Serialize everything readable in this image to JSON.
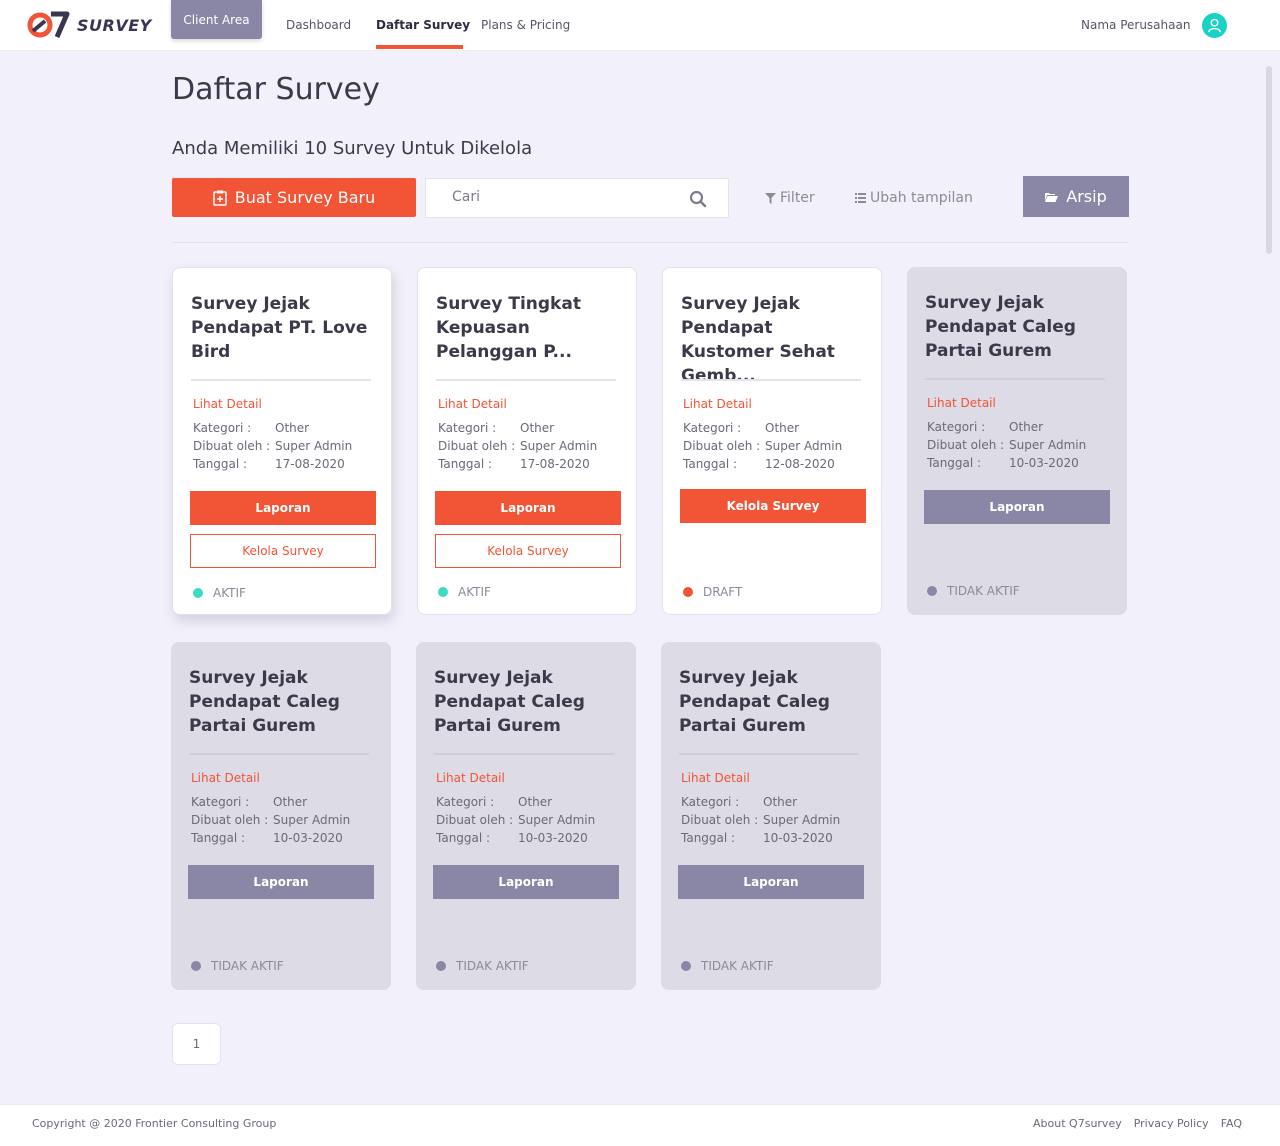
{
  "brand": {
    "logo_text": "SURVEY"
  },
  "nav": {
    "client_area": "Client Area",
    "links": [
      "Dashboard",
      "Daftar Survey",
      "Plans & Pricing"
    ],
    "company": "Nama Perusahaan"
  },
  "page": {
    "title": "Daftar Survey",
    "subtitle": "Anda Memiliki 10 Survey Untuk Dikelola"
  },
  "toolbar": {
    "new_survey": "Buat Survey Baru",
    "search_placeholder": "Cari",
    "filter": "Filter",
    "change_view": "Ubah tampilan",
    "archive": "Arsip"
  },
  "labels": {
    "detail": "Lihat Detail",
    "kategori": "Kategori :",
    "dibuat_oleh": "Dibuat oleh :",
    "tanggal": "Tanggal :",
    "laporan": "Laporan",
    "kelola": "Kelola Survey"
  },
  "colors": {
    "accent": "#f25436",
    "muted": "#8a87a6",
    "active": "#3ddbc4",
    "inactive": "#8a87a6"
  },
  "surveys": [
    {
      "title": "Survey Jejak Pendapat PT. Love Bird",
      "kategori": "Other",
      "dibuat_oleh": "Super Admin",
      "tanggal": "17-08-2020",
      "status": "AKTIF"
    },
    {
      "title": "Survey Tingkat Kepuasan Pelanggan P...",
      "kategori": "Other",
      "dibuat_oleh": "Super Admin",
      "tanggal": "17-08-2020",
      "status": "AKTIF"
    },
    {
      "title": "Survey Jejak Pendapat Kustomer Sehat Gemb...",
      "kategori": "Other",
      "dibuat_oleh": "Super Admin",
      "tanggal": "12-08-2020",
      "status": "DRAFT"
    },
    {
      "title": "Survey Jejak Pendapat Caleg Partai Gurem",
      "kategori": "Other",
      "dibuat_oleh": "Super Admin",
      "tanggal": "10-03-2020",
      "status": "TIDAK AKTIF"
    },
    {
      "title": "Survey Jejak Pendapat Caleg Partai Gurem",
      "kategori": "Other",
      "dibuat_oleh": "Super Admin",
      "tanggal": "10-03-2020",
      "status": "TIDAK AKTIF"
    },
    {
      "title": "Survey Jejak Pendapat Caleg Partai Gurem",
      "kategori": "Other",
      "dibuat_oleh": "Super Admin",
      "tanggal": "10-03-2020",
      "status": "TIDAK AKTIF"
    },
    {
      "title": "Survey Jejak Pendapat Caleg Partai Gurem",
      "kategori": "Other",
      "dibuat_oleh": "Super Admin",
      "tanggal": "10-03-2020",
      "status": "TIDAK AKTIF"
    }
  ],
  "pagination": {
    "current": "1"
  },
  "footer": {
    "copyright": "Copyright @ 2020 Frontier Consulting Group",
    "links": [
      "About Q7survey",
      "Privacy Policy",
      "FAQ"
    ]
  }
}
